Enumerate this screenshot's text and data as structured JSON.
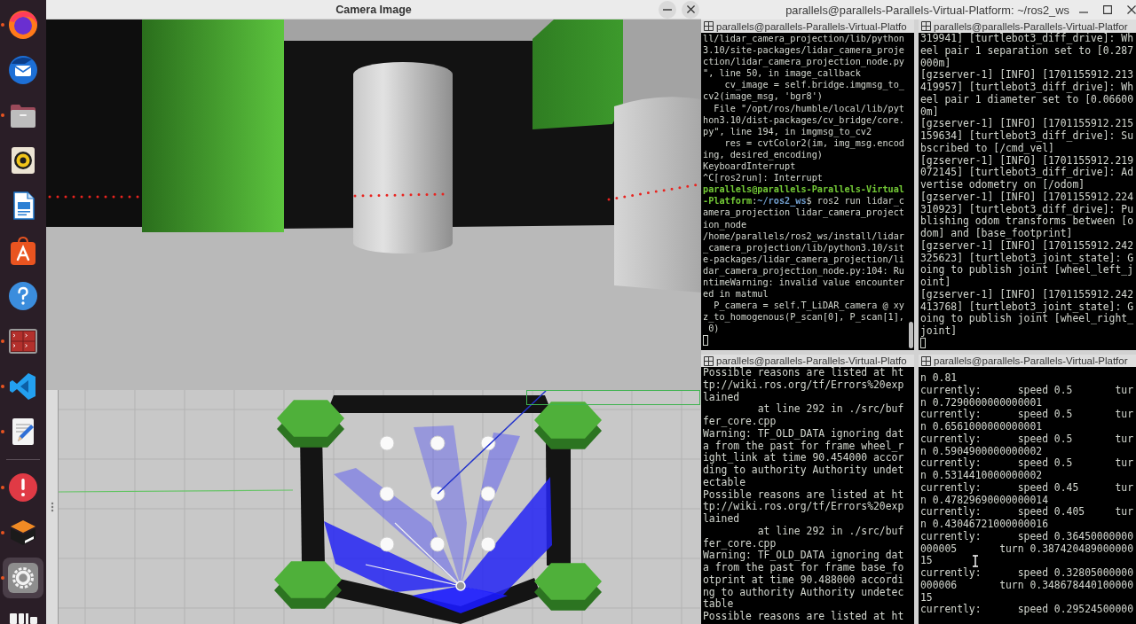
{
  "dock": {
    "groups": [
      {
        "items": [
          {
            "kind": "browser",
            "running": true,
            "selected": false
          },
          {
            "kind": "mail",
            "running": false,
            "selected": false
          },
          {
            "kind": "files",
            "running": true,
            "selected": false
          },
          {
            "kind": "music",
            "running": false,
            "selected": false
          },
          {
            "kind": "document",
            "running": false,
            "selected": false
          },
          {
            "kind": "store",
            "running": false,
            "selected": false
          },
          {
            "kind": "help",
            "running": false,
            "selected": false
          },
          {
            "kind": "terminal",
            "running": true,
            "selected": false
          },
          {
            "kind": "code",
            "running": true,
            "selected": false
          },
          {
            "kind": "editor",
            "running": true,
            "selected": false
          }
        ]
      },
      {
        "items": [
          {
            "kind": "alert",
            "running": true,
            "selected": false
          },
          {
            "kind": "simulator",
            "running": true,
            "selected": false
          },
          {
            "kind": "settings",
            "running": true,
            "selected": true
          },
          {
            "kind": "logo",
            "running": false,
            "selected": false
          }
        ]
      }
    ]
  },
  "camera_window": {
    "title": "Camera Image",
    "buttons": [
      {
        "kind": "minimize"
      },
      {
        "kind": "close"
      }
    ]
  },
  "terminal_window": {
    "title": "parallels@parallels-Parallels-Virtual-Platform: ~/ros2_ws",
    "buttons": [
      {
        "kind": "minimize"
      },
      {
        "kind": "maximize"
      },
      {
        "kind": "close"
      }
    ],
    "panes": [
      {
        "title": "parallels@parallels-Parallels-Virtual-Platfo",
        "cursor": true,
        "scrollbar": true,
        "lines": [
          "ll/lidar_camera_projection/lib/python",
          "3.10/site-packages/lidar_camera_proje",
          "ction/lidar_camera_projection_node.py",
          "\", line 50, in image_callback",
          "    cv_image = self.bridge.imgmsg_to_",
          "cv2(image_msg, 'bgr8')",
          "  File \"/opt/ros/humble/local/lib/pyt",
          "hon3.10/dist-packages/cv_bridge/core.",
          "py\", line 194, in imgmsg_to_cv2",
          "    res = cvtColor2(im, img_msg.encod",
          "ing, desired_encoding)",
          "KeyboardInterrupt",
          "^C[ros2run]: Interrupt",
          [
            {
              "text": "parallels@parallels-Parallels-Virtual",
              "kind": "user"
            }
          ],
          [
            {
              "text": "-Platform",
              "kind": "user"
            },
            {
              "text": ":",
              "kind": "plain"
            },
            {
              "text": "~/ros2_ws",
              "kind": "path"
            },
            {
              "text": "$ ros2 run lidar_c",
              "kind": "plain"
            }
          ],
          "amera_projection lidar_camera_project",
          "ion_node",
          "/home/parallels/ros2_ws/install/lidar",
          "_camera_projection/lib/python3.10/sit",
          "e-packages/lidar_camera_projection/li",
          "dar_camera_projection_node.py:104: Ru",
          "ntimeWarning: invalid value encounter",
          "ed in matmul",
          "  P_camera = self.T_LiDAR_camera @ xy",
          "z_to_homogenous(P_scan[0], P_scan[1],",
          " 0)"
        ]
      },
      {
        "title": "parallels@parallels-Parallels-Virtual-Platfor",
        "cursor": true,
        "scrollbar": false,
        "lines": [
          "319941] [turtlebot3_diff_drive]: Wh",
          "eel pair 1 separation set to [0.287",
          "000m]",
          "[gzserver-1] [INFO] [1701155912.213",
          "419957] [turtlebot3_diff_drive]: Wh",
          "eel pair 1 diameter set to [0.06600",
          "0m]",
          "[gzserver-1] [INFO] [1701155912.215",
          "159634] [turtlebot3_diff_drive]: Su",
          "bscribed to [/cmd_vel]",
          "[gzserver-1] [INFO] [1701155912.219",
          "072145] [turtlebot3_diff_drive]: Ad",
          "vertise odometry on [/odom]",
          "[gzserver-1] [INFO] [1701155912.224",
          "310923] [turtlebot3_diff_drive]: Pu",
          "blishing odom transforms between [o",
          "dom] and [base_footprint]",
          "[gzserver-1] [INFO] [1701155912.242",
          "325623] [turtlebot3_joint_state]: G",
          "oing to publish joint [wheel_left_j",
          "oint]",
          "[gzserver-1] [INFO] [1701155912.242",
          "413768] [turtlebot3_joint_state]: G",
          "oing to publish joint [wheel_right_",
          "joint]"
        ]
      },
      {
        "title": "parallels@parallels-Parallels-Virtual-Platfo",
        "cursor": false,
        "scrollbar": false,
        "lines": [
          "Possible reasons are listed at ht",
          "tp://wiki.ros.org/tf/Errors%20exp",
          "lained",
          "         at line 292 in ./src/buf",
          "fer_core.cpp",
          "Warning: TF_OLD_DATA ignoring dat",
          "a from the past for frame wheel_r",
          "ight_link at time 90.454000 accor",
          "ding to authority Authority undet",
          "ectable",
          "Possible reasons are listed at ht",
          "tp://wiki.ros.org/tf/Errors%20exp",
          "lained",
          "         at line 292 in ./src/buf",
          "fer_core.cpp",
          "Warning: TF_OLD_DATA ignoring dat",
          "a from the past for frame base_fo",
          "otprint at time 90.488000 accordi",
          "ng to authority Authority undetec",
          "table",
          "Possible reasons are listed at ht"
        ]
      },
      {
        "title": "parallels@parallels-Parallels-Virtual-Platfor",
        "cursor": false,
        "scrollbar": false,
        "lines": [
          "n 0.81",
          "currently:      speed 0.5       tur",
          "n 0.7290000000000001",
          "currently:      speed 0.5       tur",
          "n 0.6561000000000001",
          "currently:      speed 0.5       tur",
          "n 0.5904900000000002",
          "currently:      speed 0.5       tur",
          "n 0.5314410000000002",
          "currently:      speed 0.45      tur",
          "n 0.47829690000000014",
          "currently:      speed 0.405     tur",
          "n 0.43046721000000016",
          "currently:      speed 0.36450000000",
          "000005       turn 0.387420489000000",
          "15",
          "currently:      speed 0.32805000000",
          "000006       turn 0.348678440100000",
          "15",
          "currently:      speed 0.29524500000"
        ]
      }
    ]
  }
}
